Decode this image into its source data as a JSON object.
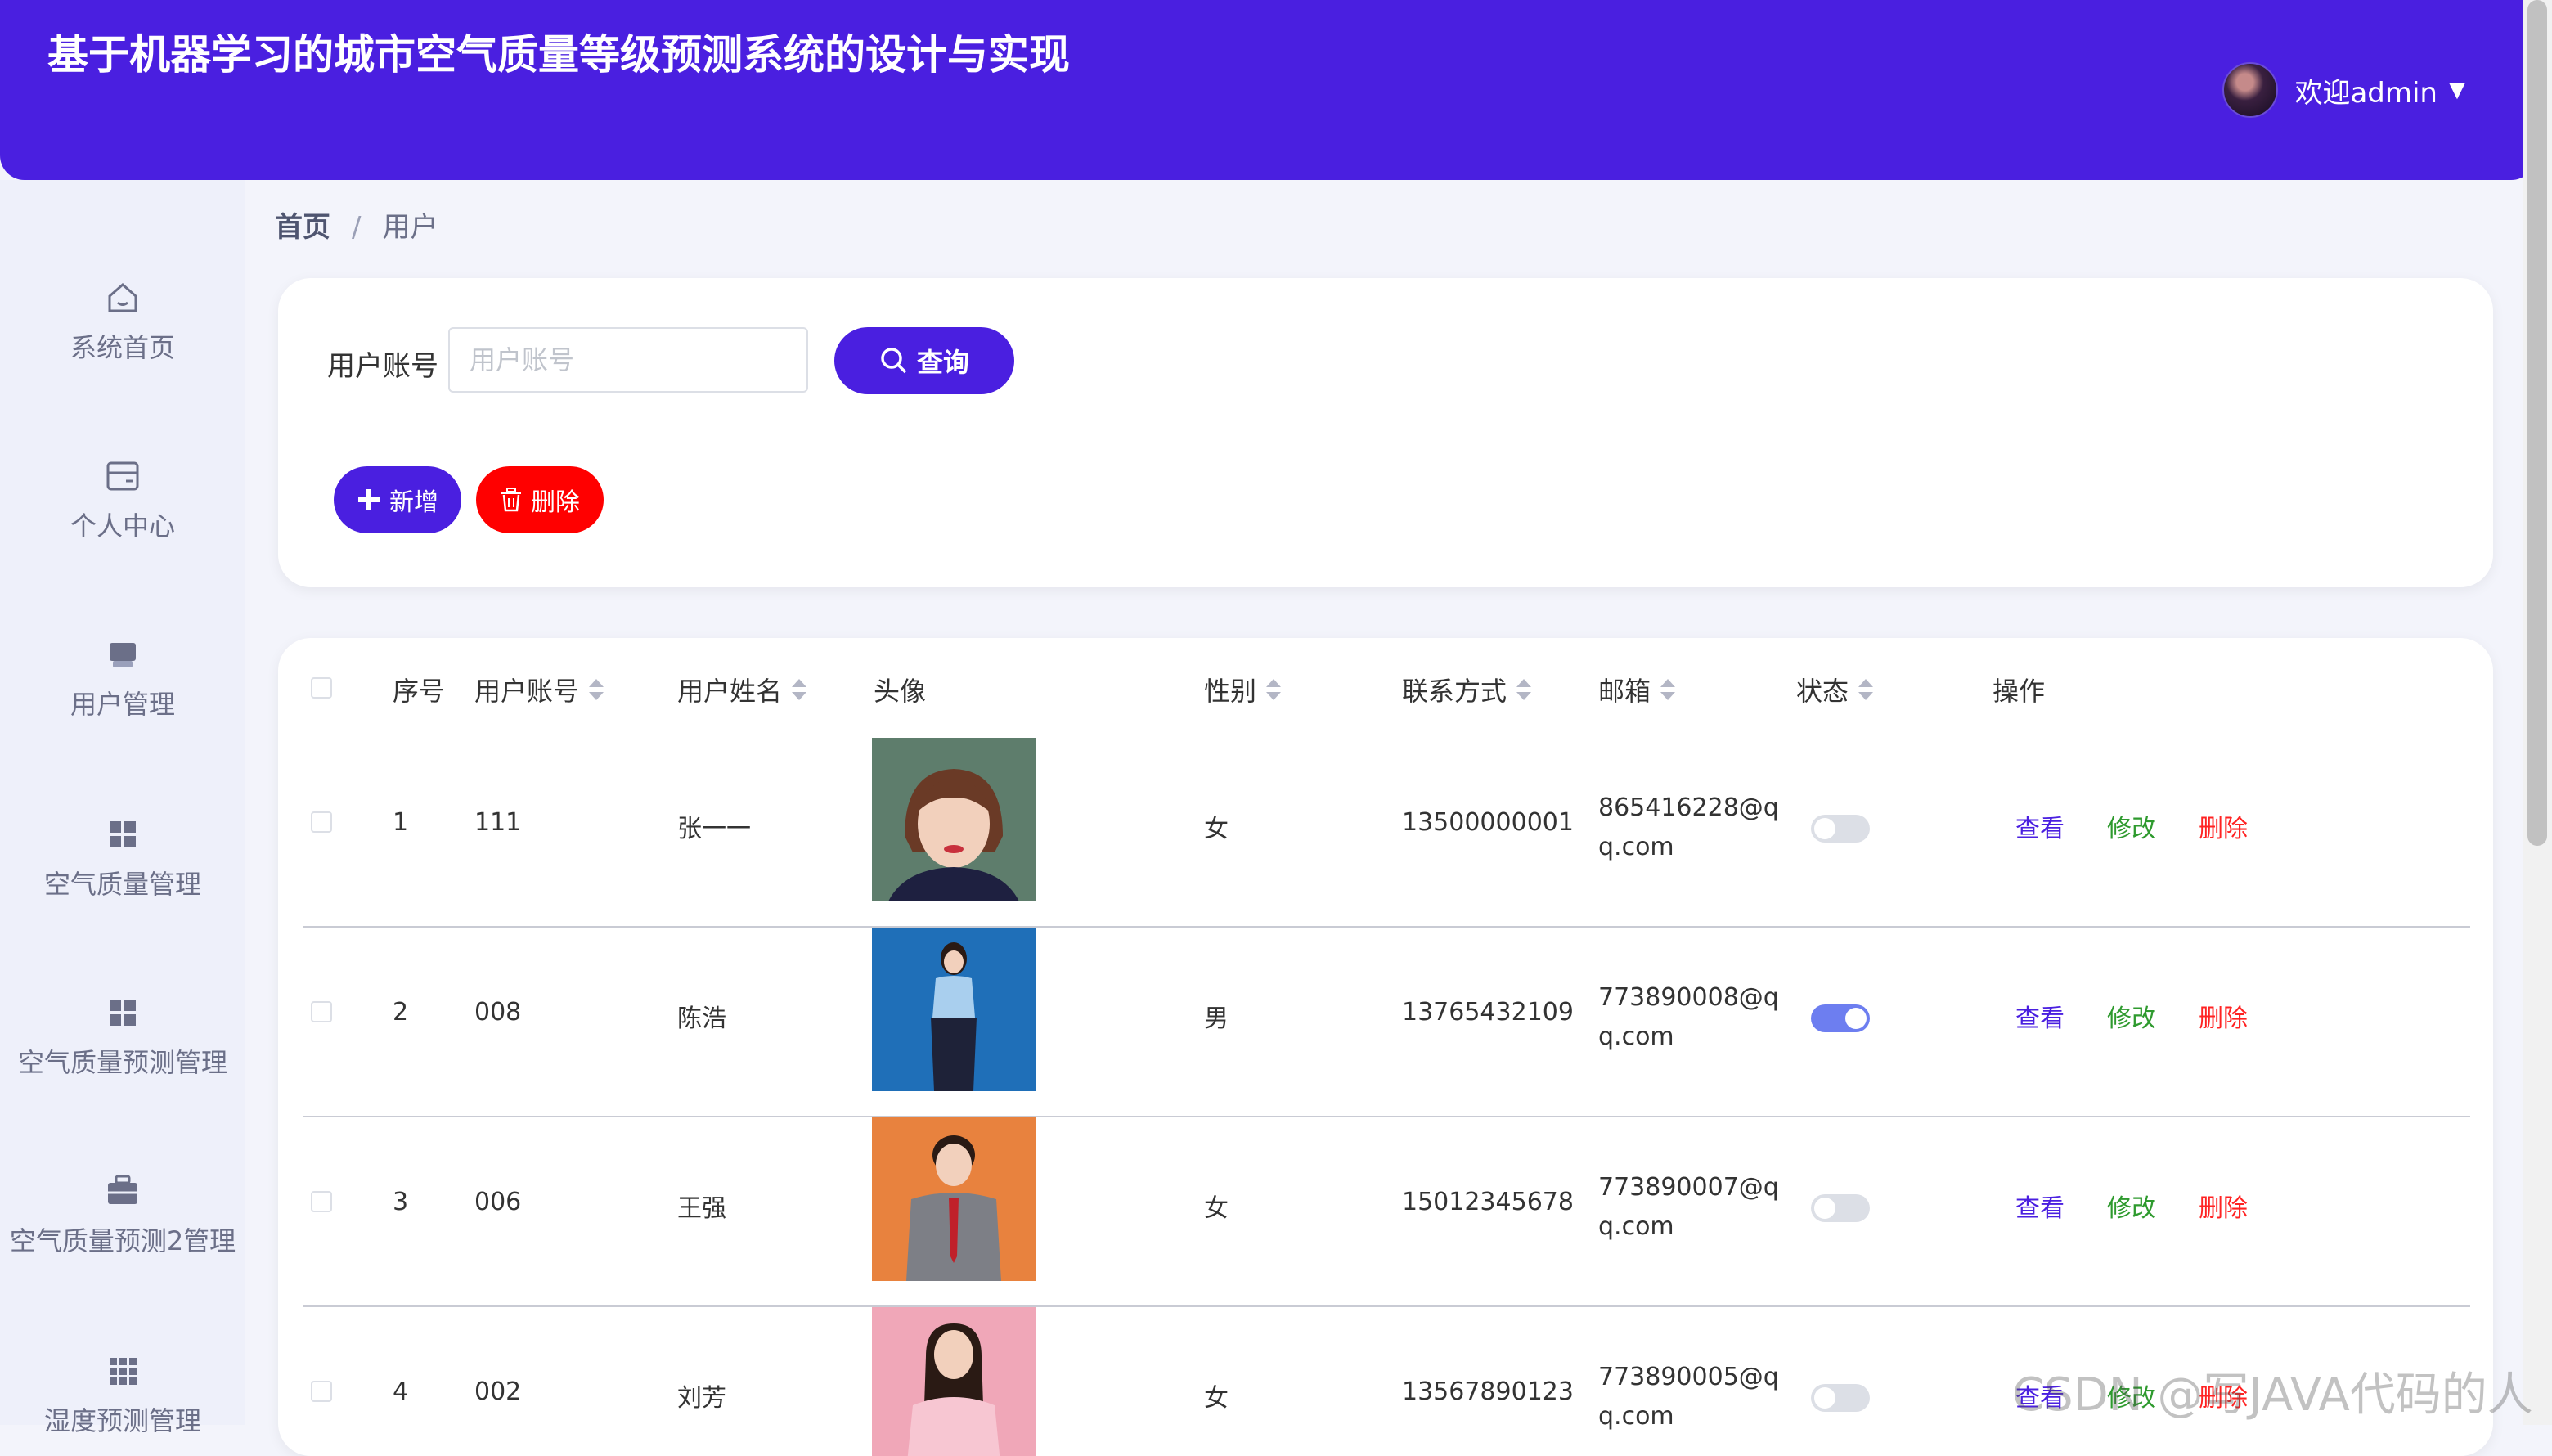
{
  "header": {
    "title": "基于机器学习的城市空气质量等级预测系统的设计与实现",
    "welcome": "欢迎admin"
  },
  "sidebar": {
    "items": [
      {
        "label": "系统首页",
        "icon": "home-icon"
      },
      {
        "label": "个人中心",
        "icon": "card-icon"
      },
      {
        "label": "用户管理",
        "icon": "user-icon"
      },
      {
        "label": "空气质量管理",
        "icon": "grid-icon"
      },
      {
        "label": "空气质量预测管理",
        "icon": "grid-icon"
      },
      {
        "label": "空气质量预测2管理",
        "icon": "briefcase-icon"
      },
      {
        "label": "湿度预测管理",
        "icon": "grid9-icon"
      }
    ]
  },
  "breadcrumb": {
    "home": "首页",
    "separator": "/",
    "current": "用户"
  },
  "search": {
    "label": "用户账号",
    "placeholder": "用户账号",
    "value": "",
    "query_label": "查询"
  },
  "toolbar": {
    "add_label": "新增",
    "delete_label": "删除"
  },
  "table": {
    "columns": [
      "序号",
      "用户账号",
      "用户姓名",
      "头像",
      "性别",
      "联系方式",
      "邮箱",
      "状态",
      "操作"
    ],
    "rows": [
      {
        "index": "1",
        "account": "111",
        "name": "张一一",
        "gender": "女",
        "phone": "13500000001",
        "email": "865416228@qq.com",
        "status": "off",
        "avatar_color": "#5e7d6c"
      },
      {
        "index": "2",
        "account": "008",
        "name": "陈浩",
        "gender": "男",
        "phone": "13765432109",
        "email": "773890008@qq.com",
        "status": "on",
        "avatar_color": "#1f6fb8"
      },
      {
        "index": "3",
        "account": "006",
        "name": "王强",
        "gender": "女",
        "phone": "15012345678",
        "email": "773890007@qq.com",
        "status": "off",
        "avatar_color": "#e8823e"
      },
      {
        "index": "4",
        "account": "002",
        "name": "刘芳",
        "gender": "女",
        "phone": "13567890123",
        "email": "773890005@qq.com",
        "status": "off",
        "avatar_color": "#f0a7b8"
      }
    ],
    "actions": {
      "view": "查看",
      "edit": "修改",
      "delete": "删除"
    }
  },
  "watermark": "CSDN @写JAVA代码的人",
  "colors": {
    "primary": "#4a1fe0",
    "danger": "#ff0000",
    "edit": "#2e9a2e"
  }
}
